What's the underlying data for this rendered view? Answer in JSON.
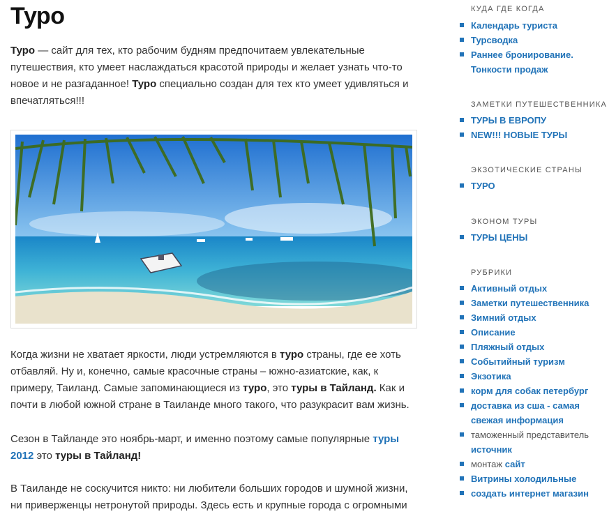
{
  "main": {
    "title": "Туро",
    "p1": {
      "b1": "Туро",
      "t1": " — сайт для тех, кто рабочим будням предпочитаем увлекательные путешествия, кто умеет наслаждаться красотой природы и желает узнать что-то новое и не разгаданное! ",
      "b2": "Туро",
      "t2": " специально создан для тех кто умеет удивляться и впечатляться!!!"
    },
    "p2": {
      "t1": "Когда жизни не хватает яркости, люди устремляются в ",
      "b1": "туро",
      "t2": " страны, где ее хоть отбавляй. Ну и, конечно, самые красочные страны – южно-азиатские, как, к примеру, Таиланд. Самые запоминающиеся из ",
      "b2": "туро",
      "t3": ", это ",
      "l1": "туры в Тайланд.",
      "t4": " Как и почти в любой южной стране в Таиланде много такого, что разукрасит вам жизнь."
    },
    "p3": {
      "t1": "Сезон в Тайланде это ноябрь-март, и именно поэтому  самые популярные ",
      "l1": "туры 2012",
      "t2": " это ",
      "b1": "туры в Тайланд!"
    },
    "p4": {
      "t1": "В Таиланде не соскучится никто: ни любители больших городов и шумной жизни, ни приверженцы нетронутой природы. Здесь есть и крупные города с огромными"
    }
  },
  "sidebar": {
    "w1": {
      "title": "КУДА ГДЕ КОГДА",
      "items": [
        "Календарь туриста",
        "Турсводка",
        "Раннее бронирование. Тонкости продаж"
      ]
    },
    "w2": {
      "title": "ЗАМЕТКИ ПУТЕШЕСТВЕННИКА",
      "items": [
        "ТУРЫ В ЕВРОПУ",
        "NEW!!! НОВЫЕ ТУРЫ"
      ]
    },
    "w3": {
      "title": "ЭКЗОТИЧЕСКИЕ СТРАНЫ",
      "items": [
        "ТУРО"
      ]
    },
    "w4": {
      "title": "ЭКОНОМ ТУРЫ",
      "items": [
        "ТУРЫ ЦЕНЫ"
      ]
    },
    "w5": {
      "title": "РУБРИКИ",
      "items": [
        "Активный отдых",
        "Заметки путешественника",
        "Зимний отдых",
        "Описание",
        "Пляжный отдых",
        "Событийный туризм",
        "Экзотика",
        "корм для собак петербург",
        "доставка из сша - самая свежая информация"
      ],
      "plain1": "таможенный представитель",
      "link1": "источник",
      "plain2": "монтаж",
      "link2": "сайт",
      "items2": [
        "Витрины холодильные",
        "создать интернет магазин"
      ]
    }
  },
  "colors": {
    "link": "#2173b8",
    "text": "#333333",
    "widget_title": "#555555"
  }
}
